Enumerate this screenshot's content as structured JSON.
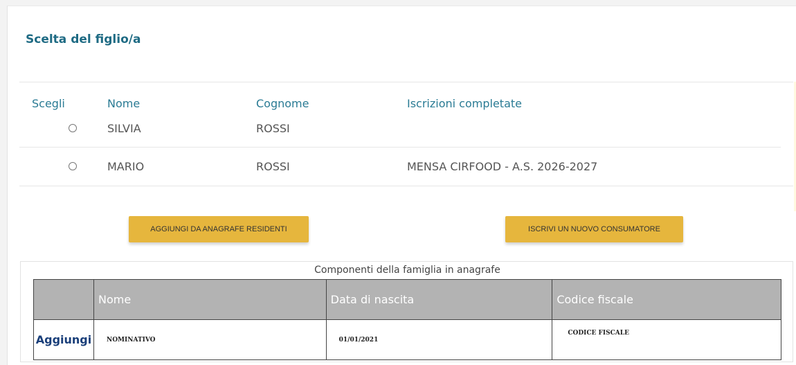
{
  "section_title": "Scelta del figlio/a",
  "children_table": {
    "headers": {
      "choose": "Scegli",
      "name": "Nome",
      "surname": "Cognome",
      "enrollments": "Iscrizioni completate"
    },
    "rows": [
      {
        "name": "SILVIA",
        "surname": "ROSSI",
        "enrollments": "",
        "selected": false
      },
      {
        "name": "MARIO",
        "surname": "ROSSI",
        "enrollments": "MENSA CIRFOOD - A.S. 2026-2027",
        "selected": false
      }
    ]
  },
  "buttons": {
    "add_from_registry": "AGGIUNGI DA ANAGRAFE RESIDENTI",
    "enroll_new": "ISCRIVI UN NUOVO CONSUMATORE"
  },
  "family": {
    "caption": "Componenti della famiglia in anagrafe",
    "headers": {
      "blank": "",
      "name": "Nome",
      "birth_date": "Data di nascita",
      "tax_code": "Codice fiscale"
    },
    "rows": [
      {
        "action": "Aggiungi",
        "name": "NOMINATIVO",
        "birth_date": "01/01/2021",
        "tax_code": "CODICE FISCALE"
      }
    ]
  },
  "colors": {
    "title": "#1f6b84",
    "header_text": "#2a7b94",
    "button": "#e6b63d",
    "table_header_bg": "#b3b3b3",
    "action_link": "#1a3f7a"
  }
}
